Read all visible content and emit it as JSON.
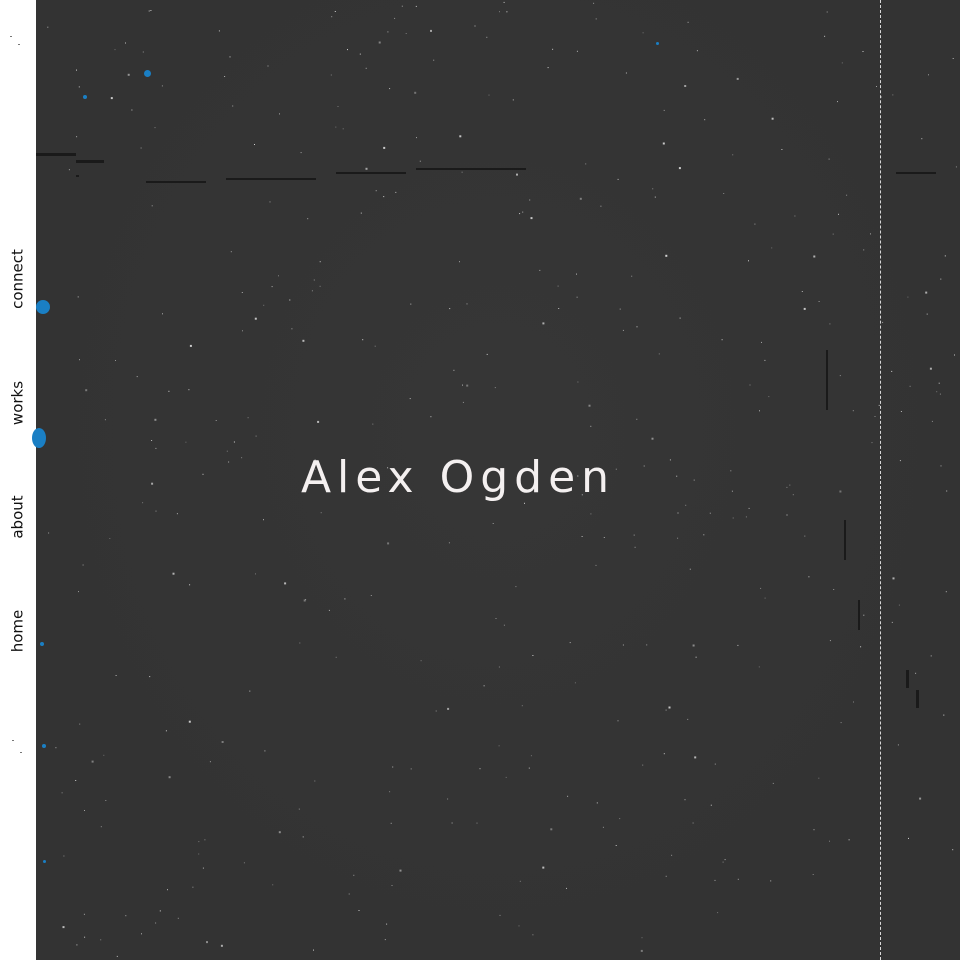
{
  "nav": {
    "items": [
      {
        "id": "connect",
        "label": "connect"
      },
      {
        "id": "works",
        "label": "works"
      },
      {
        "id": "about",
        "label": "about"
      },
      {
        "id": "home",
        "label": "home"
      }
    ]
  },
  "hero": {
    "name": "Alex Ogden"
  },
  "colors": {
    "sidebar_bg": "#ffffff",
    "canvas_bg": "#333333",
    "title_text": "#f4f0f0",
    "accent_blue": "#1a7fc4",
    "nav_text": "#111111"
  }
}
